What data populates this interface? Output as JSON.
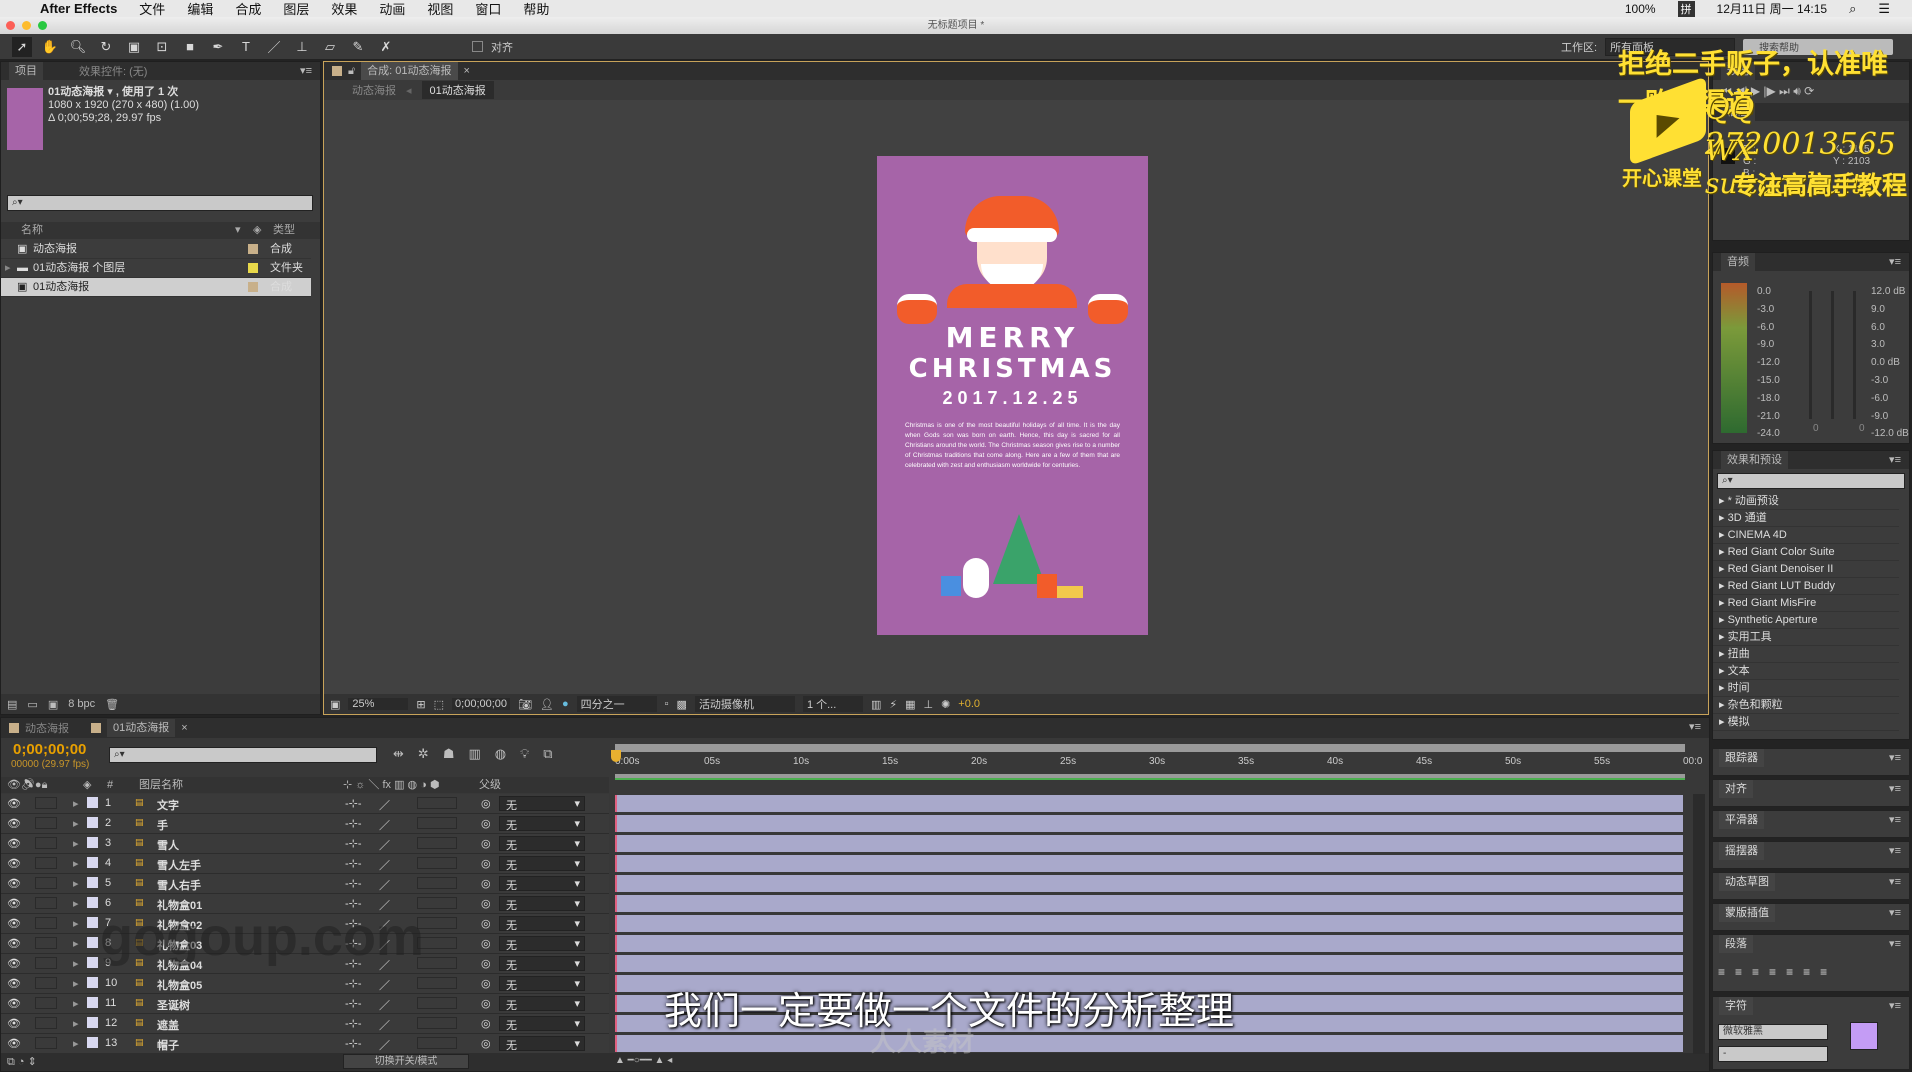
{
  "menubar": {
    "app": "After Effects",
    "items": [
      "文件",
      "编辑",
      "合成",
      "图层",
      "效果",
      "动画",
      "视图",
      "窗口",
      "帮助"
    ],
    "battery": "100%",
    "ime": "拼",
    "datetime": "12月11日 周一  14:15"
  },
  "window": {
    "title": "无标题项目 *"
  },
  "toolbar": {
    "align_label": "对齐",
    "workspace_label": "工作区:",
    "workspace_value": "所有面板",
    "help_search_placeholder": "搜索帮助"
  },
  "project": {
    "tab": "项目",
    "effects_tab": "效果控件: (无)",
    "selected_name": "01动态海报 ▾ , 使用了 1 次",
    "dims": "1080 x 1920  (270 x 480) (1.00)",
    "duration": "Δ 0;00;59;28, 29.97 fps",
    "col_name": "名称",
    "col_type": "类型",
    "items": [
      {
        "name": "动态海报",
        "type": "合成",
        "color": "#c8b08a"
      },
      {
        "name": "01动态海报 个图层",
        "type": "文件夹",
        "color": "#e8d84a"
      },
      {
        "name": "01动态海报",
        "type": "合成",
        "color": "#c8b08a"
      }
    ],
    "bpc": "8 bpc"
  },
  "comp": {
    "tab": "合成: 01动态海报",
    "breadcrumb": [
      "动态海报",
      "01动态海报"
    ],
    "zoom": "25%",
    "timecode": "0;00;00;00",
    "resolution": "四分之一",
    "camera": "活动摄像机",
    "views": "1 个...",
    "exposure": "+0.0"
  },
  "poster": {
    "line1": "MERRY",
    "line2": "CHRISTMAS",
    "date": "2017.12.25",
    "body": "Christmas is one of the most beautiful holidays of all time. It is the day when Gods son was born on earth. Hence, this day is sacred for all Christians around the world. The Christmas season gives rise to a number of Christmas traditions that come along. Here are a few of them that are celebrated with zest and enthusiasm worldwide for centuries.",
    "bg": "#a664a8"
  },
  "timeline": {
    "tabs": [
      "动态海报",
      "01动态海报"
    ],
    "timecode": "0;00;00;00",
    "frames": "00000 (29.97 fps)",
    "col_layer": "图层名称",
    "col_parent": "父级",
    "toggle_label": "切换开关/模式",
    "ruler": [
      "0:00s",
      "05s",
      "10s",
      "15s",
      "20s",
      "25s",
      "30s",
      "35s",
      "40s",
      "45s",
      "50s",
      "55s",
      "00:0"
    ],
    "layers": [
      {
        "n": "1",
        "name": "文字",
        "parent": "无"
      },
      {
        "n": "2",
        "name": "手",
        "parent": "无"
      },
      {
        "n": "3",
        "name": "雪人",
        "parent": "无"
      },
      {
        "n": "4",
        "name": "雪人左手",
        "parent": "无"
      },
      {
        "n": "5",
        "name": "雪人右手",
        "parent": "无"
      },
      {
        "n": "6",
        "name": "礼物盒01",
        "parent": "无"
      },
      {
        "n": "7",
        "name": "礼物盒02",
        "parent": "无"
      },
      {
        "n": "8",
        "name": "礼物盒03",
        "parent": "无"
      },
      {
        "n": "9",
        "name": "礼物盒04",
        "parent": "无"
      },
      {
        "n": "10",
        "name": "礼物盒05",
        "parent": "无"
      },
      {
        "n": "11",
        "name": "圣诞树",
        "parent": "无"
      },
      {
        "n": "12",
        "name": "遮盖",
        "parent": "无"
      },
      {
        "n": "13",
        "name": "帽子",
        "parent": "无"
      }
    ]
  },
  "audio": {
    "tab": "音频",
    "left": [
      "0.0",
      "-3.0",
      "-6.0",
      "-9.0",
      "-12.0",
      "-15.0",
      "-18.0",
      "-21.0",
      "-24.0"
    ],
    "right": [
      "12.0 dB",
      "9.0",
      "6.0",
      "3.0",
      "0.0 dB",
      "-3.0",
      "-6.0",
      "-9.0",
      "-12.0 dB"
    ],
    "zero_l": "0",
    "zero_r": "0"
  },
  "effects": {
    "tab": "效果和预设",
    "items": [
      "* 动画预设",
      "3D 通道",
      "CINEMA 4D",
      "Red Giant Color Suite",
      "Red Giant Denoiser II",
      "Red Giant LUT Buddy",
      "Red Giant MisFire",
      "Synthetic Aperture",
      "实用工具",
      "扭曲",
      "文本",
      "时间",
      "杂色和颗粒",
      "模拟"
    ]
  },
  "panels": [
    "跟踪器",
    "对齐",
    "平滑器",
    "摇摆器",
    "动态草图",
    "蒙版插值",
    "段落",
    "字符"
  ],
  "character": {
    "font": "微软雅黑",
    "style": "-",
    "fill_color": "#c49cf5"
  },
  "info": {
    "preview_tab": "预览",
    "info_tab": "信息",
    "x": "X : 1195",
    "y": "Y : 2103",
    "r": "R :",
    "g": "G :",
    "b": "B :"
  },
  "overlay": {
    "line1": "拒绝二手贩子，认准唯一购买渠道",
    "qq": "QQ 2720013565",
    "wx": "WX suitaozhuitu",
    "logo": "开心课堂",
    "slogan": "专注高高手教程",
    "subtitle": "我们一定要做一个文件的分析整理",
    "watermark1": "gogoup.com",
    "watermark2": "人人素材"
  }
}
